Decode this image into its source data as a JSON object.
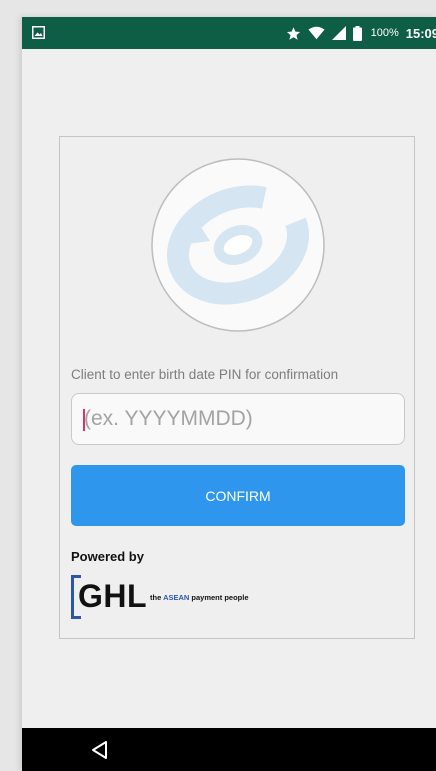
{
  "status_bar": {
    "battery_percent": "100%",
    "time": "15:09"
  },
  "card": {
    "prompt": "Client to enter birth date PIN for confirmation",
    "pin_input": {
      "value": "",
      "placeholder": "(ex. YYYYMMDD)"
    },
    "confirm_label": "CONFIRM",
    "powered_by": "Powered by",
    "brand": {
      "name": "GHL",
      "tagline_prefix": "the ",
      "tagline_highlight": "ASEAN",
      "tagline_suffix": " payment people"
    }
  },
  "colors": {
    "status_bar": "#0d5e45",
    "confirm_button": "#2f96ee",
    "brand_blue": "#2c57a6",
    "logo_ring": "#d5e6f2"
  },
  "icons": {
    "status_left": "image-icon",
    "status_right": [
      "star-icon",
      "wifi-icon",
      "signal-icon",
      "battery-icon"
    ],
    "nav": [
      "back-icon"
    ],
    "logo": "refresh-logo-icon"
  }
}
